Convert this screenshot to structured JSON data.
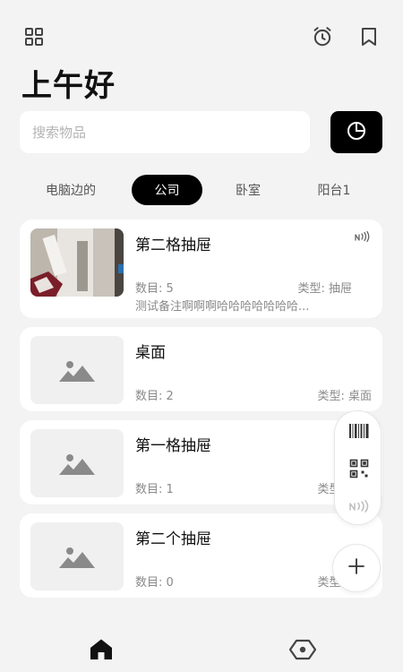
{
  "header": {
    "greeting": "上午好",
    "icons": [
      "grid-icon",
      "alarm-icon",
      "bookmark-icon"
    ]
  },
  "search": {
    "placeholder": "搜索物品",
    "value": ""
  },
  "stats_icon": "pie-chart-icon",
  "tabs": [
    {
      "label": "电脑边的",
      "active": false
    },
    {
      "label": "公司",
      "active": true
    },
    {
      "label": "卧室",
      "active": false
    },
    {
      "label": "阳台1",
      "active": false
    }
  ],
  "items": [
    {
      "title": "第二格抽屉",
      "count_label": "数目: 5",
      "type_label": "类型: 抽屉",
      "note": "测试备注啊啊啊哈哈哈哈哈哈哈...",
      "has_photo": true,
      "nfc": true
    },
    {
      "title": "桌面",
      "count_label": "数目: 2",
      "type_label": "类型: 桌面",
      "note": "",
      "has_photo": false,
      "nfc": false
    },
    {
      "title": "第一格抽屉",
      "count_label": "数目: 1",
      "type_label": "类型: 抽屉",
      "note": "",
      "has_photo": false,
      "nfc": false
    },
    {
      "title": "第二个抽屉",
      "count_label": "数目: 0",
      "type_label": "类型: 抽屉",
      "note": "",
      "has_photo": false,
      "nfc": false
    }
  ],
  "tools": [
    "barcode-icon",
    "qr-code-icon",
    "nfc-icon",
    "add-icon"
  ],
  "bottom_nav": [
    "home-icon",
    "eye-icon"
  ],
  "colors": {
    "background": "#f3f3f3",
    "card": "#ffffff",
    "accent": "#000000",
    "muted_text": "#8a8a8a"
  }
}
